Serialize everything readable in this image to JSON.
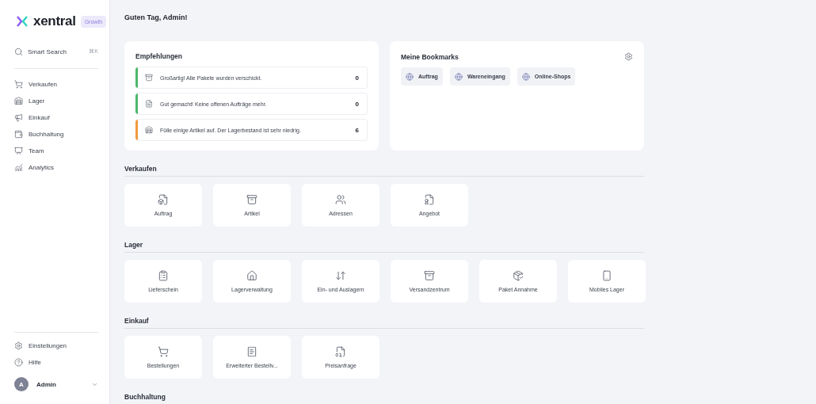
{
  "sidebar": {
    "logo": "xentral",
    "plan_badge": "Growth",
    "search": {
      "label": "Smart Search",
      "shortcut": "⌘K"
    },
    "nav": [
      {
        "label": "Verkaufen"
      },
      {
        "label": "Lager"
      },
      {
        "label": "Einkauf"
      },
      {
        "label": "Buchhaltung"
      },
      {
        "label": "Team"
      },
      {
        "label": "Analytics"
      }
    ],
    "footer": [
      {
        "label": "Einstellungen"
      },
      {
        "label": "Hilfe"
      }
    ],
    "user": {
      "initial": "A",
      "name": "Admin"
    }
  },
  "greeting": "Guten Tag, Admin!",
  "recommendations": {
    "title": "Empfehlungen",
    "items": [
      {
        "text": "Großartig! Alle Pakete wurden verschickt.",
        "count": "0",
        "color": "#4cb86a"
      },
      {
        "text": "Gut gemacht! Keine offenen Aufträge mehr.",
        "count": "0",
        "color": "#4cb86a"
      },
      {
        "text": "Fülle einige Artikel auf. Der Lagerbestand ist sehr niedrig.",
        "count": "6",
        "color": "#f09a3e"
      }
    ]
  },
  "bookmarks": {
    "title": "Meine Bookmarks",
    "items": [
      {
        "label": "Auftrag"
      },
      {
        "label": "Wareneingang"
      },
      {
        "label": "Online-Shops"
      }
    ]
  },
  "sections": [
    {
      "title": "Verkaufen",
      "tiles": [
        {
          "label": "Auftrag"
        },
        {
          "label": "Artikel"
        },
        {
          "label": "Adressen"
        },
        {
          "label": "Angebot"
        }
      ]
    },
    {
      "title": "Lager",
      "tiles": [
        {
          "label": "Lieferschein"
        },
        {
          "label": "Lagerverwaltung"
        },
        {
          "label": "Ein- und Auslagern"
        },
        {
          "label": "Versandzentrum"
        },
        {
          "label": "Paket Annahme"
        },
        {
          "label": "Mobiles Lager"
        }
      ]
    },
    {
      "title": "Einkauf",
      "tiles": [
        {
          "label": "Bestellungen"
        },
        {
          "label": "Erweiterter Bestellv..."
        },
        {
          "label": "Preisanfrage"
        }
      ]
    },
    {
      "title": "Buchhaltung"
    }
  ]
}
